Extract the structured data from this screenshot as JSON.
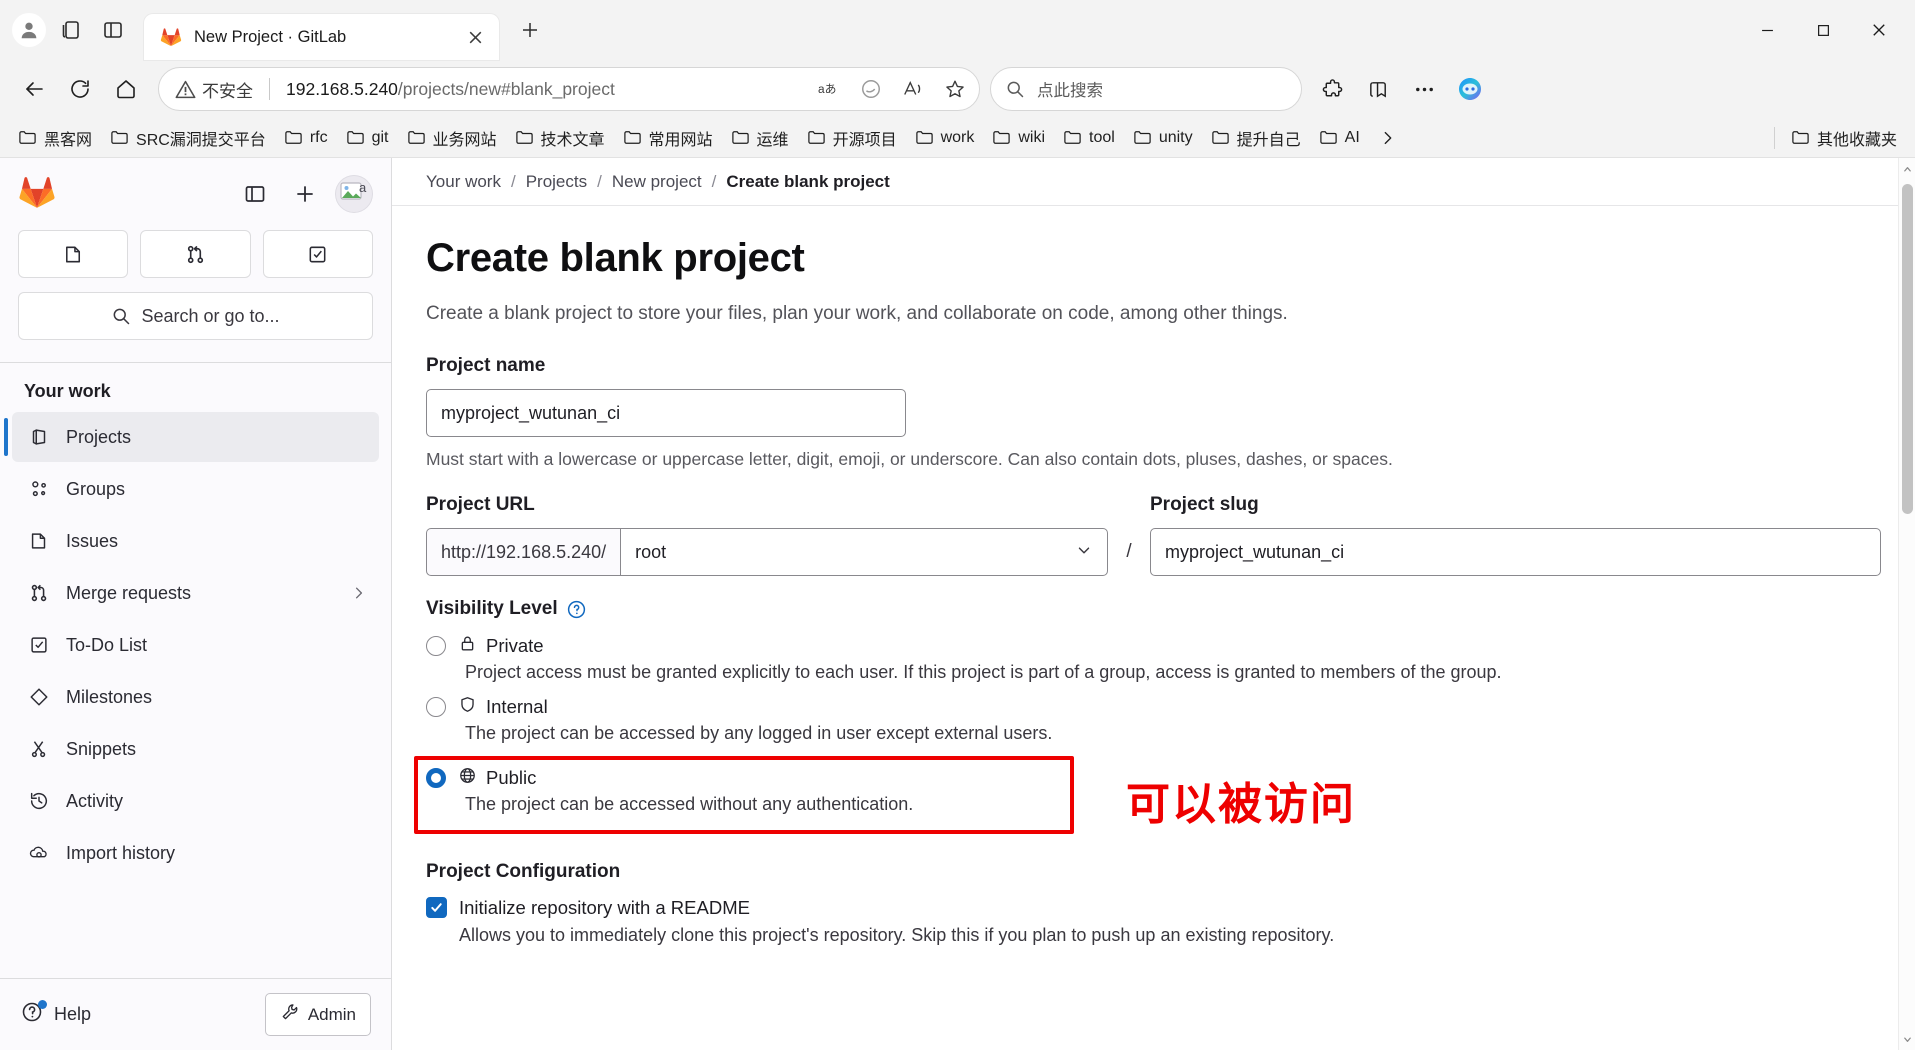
{
  "browser": {
    "tab": {
      "title": "New Project · GitLab",
      "favicon": "gitlab-icon"
    },
    "toolbar_icons": [
      "profile-icon",
      "collections-icon",
      "split-screen-icon"
    ],
    "new_tab_label": "+",
    "window_controls": [
      "minimize",
      "maximize",
      "close"
    ],
    "address": {
      "security_label": "不安全",
      "url_host": "192.168.5.240",
      "url_path": "/projects/new#blank_project",
      "actions": [
        "translate-icon",
        "copilot-icon",
        "read-aloud-icon",
        "favorite-icon"
      ]
    },
    "search": {
      "placeholder": "点此搜索"
    },
    "right_actions": [
      "extensions-icon",
      "collections-icon",
      "settings-more-icon",
      "copilot-sidebar-icon"
    ],
    "bookmarks": [
      {
        "label": "黑客网"
      },
      {
        "label": "SRC漏洞提交平台"
      },
      {
        "label": "rfc"
      },
      {
        "label": "git"
      },
      {
        "label": "业务网站"
      },
      {
        "label": "技术文章"
      },
      {
        "label": "常用网站"
      },
      {
        "label": "运维"
      },
      {
        "label": "开源项目"
      },
      {
        "label": "work"
      },
      {
        "label": "wiki"
      },
      {
        "label": "tool"
      },
      {
        "label": "unity"
      },
      {
        "label": "提升自己"
      },
      {
        "label": "AI"
      }
    ],
    "bookmarks_overflow": "›",
    "other_bookmarks": {
      "label": "其他收藏夹"
    }
  },
  "sidebar": {
    "logo": "gitlab-logo",
    "top_actions": [
      "toggle-sidebar-icon",
      "create-new-icon",
      "user-avatar"
    ],
    "quick_tabs": [
      "issues-icon",
      "merge-requests-icon",
      "todo-icon"
    ],
    "search": {
      "label": "Search or go to..."
    },
    "section_title": "Your work",
    "items": [
      {
        "label": "Projects",
        "icon": "project-icon",
        "active": true,
        "chevron": false
      },
      {
        "label": "Groups",
        "icon": "group-icon",
        "active": false,
        "chevron": false
      },
      {
        "label": "Issues",
        "icon": "issues-icon",
        "active": false,
        "chevron": false
      },
      {
        "label": "Merge requests",
        "icon": "merge-requests-icon",
        "active": false,
        "chevron": true
      },
      {
        "label": "To-Do List",
        "icon": "todo-icon",
        "active": false,
        "chevron": false
      },
      {
        "label": "Milestones",
        "icon": "milestone-icon",
        "active": false,
        "chevron": false
      },
      {
        "label": "Snippets",
        "icon": "snippet-icon",
        "active": false,
        "chevron": false
      },
      {
        "label": "Activity",
        "icon": "activity-icon",
        "active": false,
        "chevron": false
      },
      {
        "label": "Import history",
        "icon": "import-icon",
        "active": false,
        "chevron": false
      }
    ],
    "help_label": "Help",
    "admin_label": "Admin"
  },
  "main": {
    "breadcrumb": [
      {
        "label": "Your work"
      },
      {
        "label": "Projects"
      },
      {
        "label": "New project"
      },
      {
        "label": "Create blank project"
      }
    ],
    "breadcrumb_sep": "/",
    "title": "Create blank project",
    "subtitle": "Create a blank project to store your files, plan your work, and collaborate on code, among other things.",
    "project_name": {
      "label": "Project name",
      "value": "myproject_wutunan_ci",
      "hint": "Must start with a lowercase or uppercase letter, digit, emoji, or underscore. Can also contain dots, pluses, dashes, or spaces."
    },
    "project_url": {
      "label": "Project URL",
      "prefix": "http://192.168.5.240/",
      "namespace": "root",
      "separator": "/"
    },
    "project_slug": {
      "label": "Project slug",
      "value": "myproject_wutunan_ci"
    },
    "visibility": {
      "label": "Visibility Level",
      "help_icon": "question-circle-icon",
      "options": [
        {
          "value": "private",
          "label": "Private",
          "icon": "lock-icon",
          "selected": false,
          "description": "Project access must be granted explicitly to each user. If this project is part of a group, access is granted to members of the group."
        },
        {
          "value": "internal",
          "label": "Internal",
          "icon": "shield-icon",
          "selected": false,
          "description": "The project can be accessed by any logged in user except external users."
        },
        {
          "value": "public",
          "label": "Public",
          "icon": "globe-icon",
          "selected": true,
          "description": "The project can be accessed without any authentication."
        }
      ]
    },
    "annotation": {
      "text": "可以被访问",
      "color": "#ee0000"
    },
    "project_configuration": {
      "label": "Project Configuration",
      "readme": {
        "checked": true,
        "label": "Initialize repository with a README",
        "description": "Allows you to immediately clone this project's repository. Skip this if you plan to push up an existing repository."
      }
    }
  },
  "colors": {
    "accent": "#1068bf",
    "annotation": "#ee0000",
    "gitlab_orange": "#fc6d26",
    "sidebar_bg": "#fbfafd"
  }
}
